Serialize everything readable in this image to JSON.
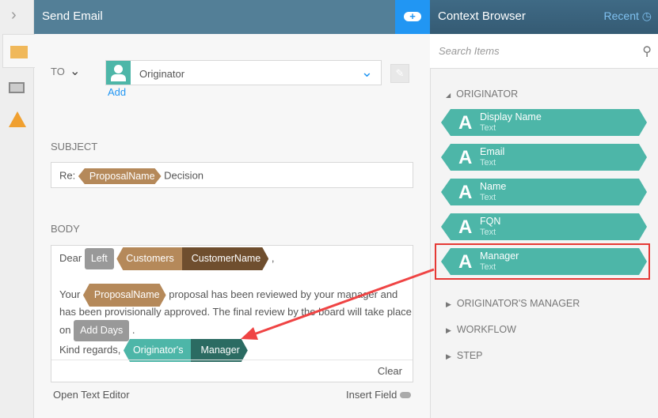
{
  "header": {
    "title": "Send Email",
    "context_title": "Context Browser",
    "recent_label": "Recent"
  },
  "to": {
    "label": "TO",
    "recipient": "Originator",
    "add_label": "Add"
  },
  "subject": {
    "label": "SUBJECT",
    "prefix": "Re:",
    "field": "ProposalName",
    "suffix": "Decision"
  },
  "body": {
    "label": "BODY",
    "dear": "Dear",
    "left_fn": "Left",
    "cust_a": "Customers",
    "cust_b": "CustomerName",
    "comma": ",",
    "your": "Your",
    "proposal": "ProposalName",
    "text1": "proposal has been reviewed by your manager and",
    "text2": "has been provisionally approved. The final review by the board will take place",
    "on": "on",
    "add_days": "Add Days",
    "dot": ".",
    "kind": "Kind regards,",
    "orig_a": "Originator's",
    "orig_b": "Manager",
    "clear": "Clear",
    "open_editor": "Open Text Editor",
    "insert_field": "Insert Field"
  },
  "context": {
    "search_placeholder": "Search Items",
    "section": "ORIGINATOR",
    "items": [
      {
        "name": "Display Name",
        "type": "Text"
      },
      {
        "name": "Email",
        "type": "Text"
      },
      {
        "name": "Name",
        "type": "Text"
      },
      {
        "name": "FQN",
        "type": "Text"
      },
      {
        "name": "Manager",
        "type": "Text"
      }
    ],
    "sections": [
      "ORIGINATOR'S MANAGER",
      "WORKFLOW",
      "STEP"
    ]
  },
  "colors": {
    "accent": "#2196f3",
    "header": "#537f97",
    "tag_teal": "#4db6a8",
    "tag_brown": "#b5895a",
    "highlight": "#e53935"
  }
}
